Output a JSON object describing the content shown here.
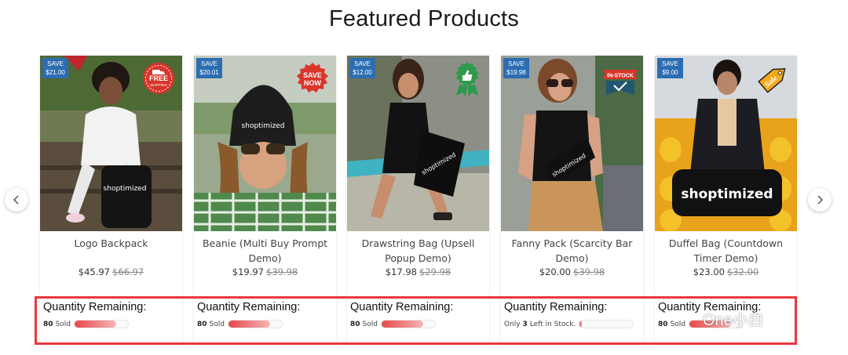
{
  "page_title": "Featured Products",
  "products": [
    {
      "save": "SAVE",
      "save_amount": "$21.00",
      "badge": "FREE SHIPPING",
      "badge_l1": "FREE",
      "badge_l2": "SHIPPING",
      "name": "Logo Backpack",
      "price": "$45.97",
      "was": "$66.97",
      "qty_label": "Quantity Remaining:",
      "sold_num": "80",
      "sold_txt": "Sold",
      "fill": 0.78
    },
    {
      "save": "SAVE",
      "save_amount": "$20.01",
      "badge": "SAVE NOW",
      "badge_l1": "SAVE",
      "badge_l2": "NOW",
      "name": "Beanie (Multi Buy Prompt Demo)",
      "price": "$19.97",
      "was": "$39.98",
      "qty_label": "Quantity Remaining:",
      "sold_num": "80",
      "sold_txt": "Sold",
      "fill": 0.78
    },
    {
      "save": "SAVE",
      "save_amount": "$12.00",
      "badge": "BEST SELLER",
      "name": "Drawstring Bag (Upsell Popup Demo)",
      "price": "$17.98",
      "was": "$29.98",
      "qty_label": "Quantity Remaining:",
      "sold_num": "80",
      "sold_txt": "Sold",
      "fill": 0.78
    },
    {
      "save": "SAVE",
      "save_amount": "$19.98",
      "badge": "IN-STOCK",
      "name": "Fanny Pack (Scarcity Bar Demo)",
      "price": "$20.00",
      "was": "$39.98",
      "qty_label": "Quantity Remaining:",
      "stock_pre": "Only",
      "stock_num": "3",
      "stock_post": "Left in Stock.",
      "fill": 0.04
    },
    {
      "save": "SAVE",
      "save_amount": "$9.00",
      "badge": "Sale",
      "name": "Duffel Bag (Countdown Timer Demo)",
      "price": "$23.00",
      "was": "$32.00",
      "qty_label": "Quantity Remaining:",
      "sold_num": "80",
      "sold_txt": "Sold",
      "fill": 0.78
    }
  ],
  "brand": "shoptimized",
  "watermark": "One小白",
  "colors": {
    "save_badge": "#2c6db1",
    "highlight": "#e8383d",
    "progress": "#e8474a",
    "instock_ribbon": "#d9352b",
    "check_badge": "#1f5670",
    "best_seller": "#2e9a4b",
    "sale_tag": "#f2a91e"
  },
  "icons": [
    "chevron-left-icon",
    "chevron-right-icon",
    "free-shipping-truck-icon",
    "thumbs-up-icon",
    "checkmark-icon"
  ]
}
